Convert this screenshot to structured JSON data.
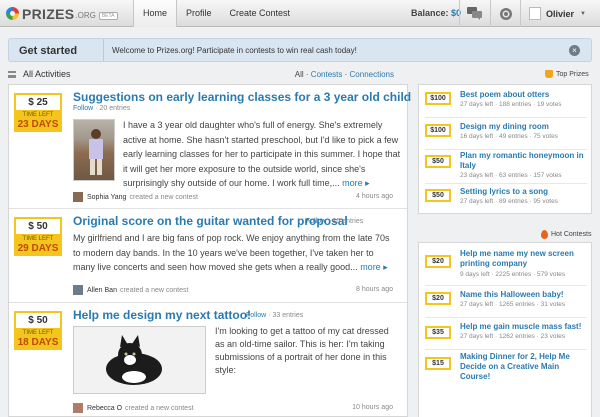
{
  "brand": {
    "name": "PRIZES",
    "tld": ".ORG",
    "badge": "BETA"
  },
  "nav": [
    {
      "label": "Home"
    },
    {
      "label": "Profile"
    },
    {
      "label": "Create Contest"
    }
  ],
  "balance": {
    "label": "Balance:",
    "amount": "$0"
  },
  "user": {
    "name": "Olivier"
  },
  "banner": {
    "title": "Get started",
    "text": "Welcome to Prizes.org! Participate in contests to win real cash today!"
  },
  "activities": {
    "title": "All Activities",
    "filter_all": "All",
    "filter_sep": "·",
    "filter_contests": "Contests",
    "filter_connections": "Connections"
  },
  "feed": [
    {
      "amount": "$ 25",
      "time_left_label": "TIME LEFT",
      "time_left": "23 DAYS",
      "title": "Suggestions on early learning classes for a 3 year old child",
      "follow": "Follow",
      "entries": "20 entries",
      "body": "I have a 3 year old daughter who's full of energy. She's extremely active at home. She hasn't started preschool, but I'd like to pick a few early learning classes for her to participate in this summer. I hope that it will get her more exposure to the outside world, since she's surprisingly shy outside of our home. I work full time,...",
      "more": "more ▸",
      "user": "Sophia Yang",
      "action": "created a new contest",
      "time": "4 hours ago"
    },
    {
      "amount": "$ 50",
      "time_left_label": "TIME LEFT",
      "time_left": "29 DAYS",
      "title": "Original score on the guitar wanted for proposal",
      "follow": "Follow",
      "entries": "15 entries",
      "body": "My girlfriend and I are big fans of pop rock. We enjoy anything from the late 70s to modern day bands. In the 10 years we've been together, I've taken her to many live concerts and seen how moved she gets when a really good...",
      "more": "more ▸",
      "user": "Allen Ban",
      "action": "created a new contest",
      "time": "8 hours ago"
    },
    {
      "amount": "$ 50",
      "time_left_label": "TIME LEFT",
      "time_left": "18 DAYS",
      "title": "Help me design my next tattoo!",
      "follow": "Follow",
      "entries": "33 entries",
      "body": "I'm looking to get a tattoo of my cat dressed as an old-time sailor.  This is her:  I'm taking submissions of a portrait of her done in this style:",
      "user": "Rebecca O",
      "action": "created a new contest",
      "time": "10 hours ago"
    }
  ],
  "top_prizes": {
    "label": "Top Prizes",
    "items": [
      {
        "amount": "$100",
        "title": "Best poem about otters",
        "days": "27 days left",
        "entries": "188 entries",
        "votes": "19 votes"
      },
      {
        "amount": "$100",
        "title": "Design my dining room",
        "days": "16 days left",
        "entries": "49 entries",
        "votes": "75 votes"
      },
      {
        "amount": "$50",
        "title": "Plan my romantic honeymoon in Italy",
        "days": "23 days left",
        "entries": "63 entries",
        "votes": "157 votes"
      },
      {
        "amount": "$50",
        "title": "Setting lyrics to a song",
        "days": "27 days left",
        "entries": "89 entries",
        "votes": "95 votes"
      }
    ]
  },
  "hot_contests": {
    "label": "Hot Contests",
    "items": [
      {
        "amount": "$20",
        "title": "Help me name my new screen printing company",
        "days": "9 days left",
        "entries": "2225 entries",
        "votes": "579 votes"
      },
      {
        "amount": "$20",
        "title": "Name this Halloween baby!",
        "days": "27 days left",
        "entries": "1265 entries",
        "votes": "31 votes"
      },
      {
        "amount": "$35",
        "title": "Help me gain muscle mass fast!",
        "days": "27 days left",
        "entries": "1262 entries",
        "votes": "23 votes"
      },
      {
        "amount": "$15",
        "title": "Making Dinner for 2, Help Me Decide on a Creative Main Course!",
        "days": "",
        "entries": "",
        "votes": ""
      }
    ]
  },
  "colors": {
    "link": "#2a7ab0",
    "gold": "#f3c51d",
    "days": "#c24a00",
    "banner_bg": "#d9e6f2"
  }
}
